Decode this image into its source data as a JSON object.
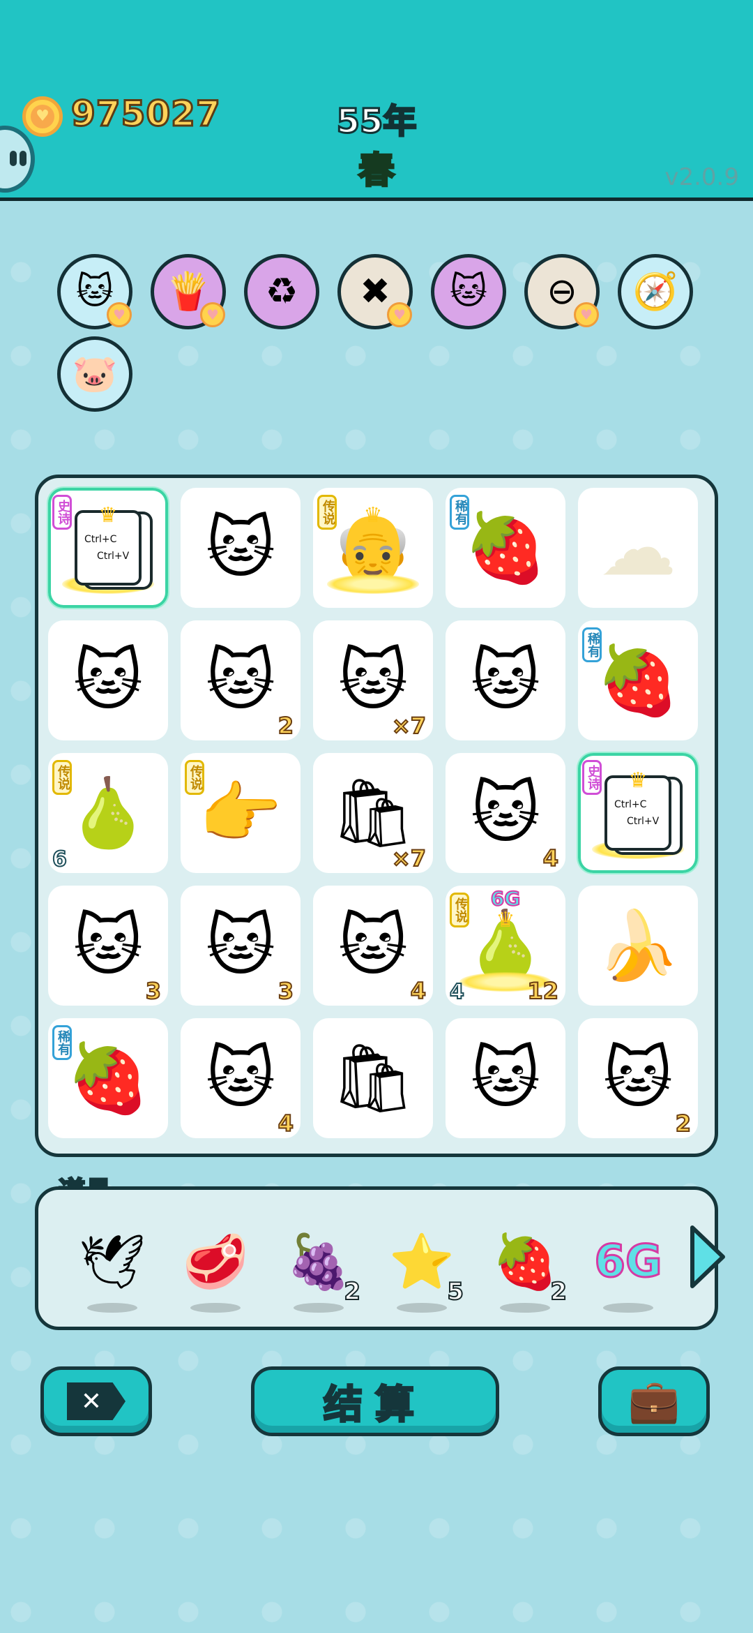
{
  "header": {
    "coins": "975027",
    "year": "55年",
    "season": "春",
    "version": "v2.0.9"
  },
  "powerups": [
    {
      "name": "cat-face-powerup",
      "icon": "cat-icon",
      "bg": "#c7eef7"
    },
    {
      "name": "fries-powerup",
      "icon": "fries-icon",
      "bg": "#d9a5e8"
    },
    {
      "name": "recycle-powerup",
      "icon": "recycle-icon",
      "bg": "#d9a5e8"
    },
    {
      "name": "remove-powerup",
      "icon": "remove-tag-icon",
      "bg": "#ece4d6"
    },
    {
      "name": "double-cat-powerup",
      "icon": "cats-icon",
      "bg": "#d9a5e8"
    },
    {
      "name": "minus-powerup",
      "icon": "minus-circle-icon",
      "bg": "#ece4d6"
    },
    {
      "name": "compass-powerup",
      "icon": "compass-icon",
      "bg": "#c7eef7"
    },
    {
      "name": "piggy-bank-powerup",
      "icon": "piggy-bank-icon",
      "bg": "#c7eef7"
    }
  ],
  "badges": {
    "epic": "史诗",
    "legend": "传说",
    "rare": "稀有"
  },
  "ctrl_card": {
    "line1": "Ctrl+C",
    "line2": "Ctrl+V"
  },
  "board": {
    "rows": [
      [
        {
          "item": "ctrl-card",
          "badge": "epic",
          "crown": true,
          "halo": true,
          "glow": true
        },
        {
          "item": "cat"
        },
        {
          "item": "old-man",
          "badge": "legend",
          "crown": true,
          "halo": true
        },
        {
          "item": "lychee",
          "badge": "rare"
        },
        {
          "item": "cotton"
        }
      ],
      [
        {
          "item": "cat"
        },
        {
          "item": "cat",
          "br": "2"
        },
        {
          "item": "cat",
          "br": "×7"
        },
        {
          "item": "cat"
        },
        {
          "item": "lychee",
          "badge": "rare"
        }
      ],
      [
        {
          "item": "pear",
          "badge": "legend",
          "bl": "6"
        },
        {
          "item": "pointing-hand",
          "badge": "legend"
        },
        {
          "item": "trash-bag",
          "br": "×7"
        },
        {
          "item": "cat",
          "br": "4"
        },
        {
          "item": "ctrl-card",
          "badge": "epic",
          "crown": true,
          "halo": true,
          "glow": true
        }
      ],
      [
        {
          "item": "cat",
          "br": "3"
        },
        {
          "item": "cat",
          "br": "3"
        },
        {
          "item": "cat",
          "br": "4"
        },
        {
          "item": "pear",
          "badge": "legend",
          "crown": true,
          "halo": true,
          "top": "6G",
          "bl": "4",
          "br": "12"
        },
        {
          "item": "banana"
        }
      ],
      [
        {
          "item": "lychee",
          "badge": "rare"
        },
        {
          "item": "cat",
          "br": "4"
        },
        {
          "item": "trash-bag"
        },
        {
          "item": "cat"
        },
        {
          "item": "cat",
          "br": "2"
        }
      ]
    ]
  },
  "item_glyphs": {
    "cat": "🐱",
    "lychee": "🍓",
    "cotton": "☁",
    "old-man": "👴",
    "pear": "🍐",
    "pointing-hand": "👉",
    "trash-bag": "🛍",
    "banana": "🍌"
  },
  "props": {
    "label": "道具",
    "items": [
      {
        "name": "bird-prop",
        "icon": "🕊",
        "count": ""
      },
      {
        "name": "liver-prop",
        "icon": "🥩",
        "count": ""
      },
      {
        "name": "bayberry-prop",
        "icon": "🍇",
        "count": "2"
      },
      {
        "name": "star-prop",
        "icon": "⭐",
        "count": "5"
      },
      {
        "name": "strawberry-prop",
        "icon": "🍓",
        "count": "2"
      },
      {
        "name": "6g-prop",
        "icon": "6G",
        "count": ""
      }
    ]
  },
  "buttons": {
    "remove_icon": "✕",
    "settle": "结算",
    "bag_icon": "💼"
  },
  "colors": {
    "header_bg": "#21c4c4",
    "page_bg": "#a7dde6",
    "board_bg": "#dceff1",
    "coin_text": "#ffd35a",
    "season_text": "#3bd45a"
  }
}
